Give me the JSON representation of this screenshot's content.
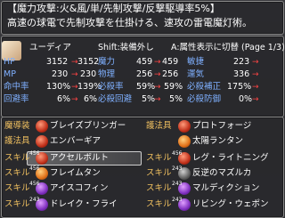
{
  "skill_header": "【魔力攻撃:火&風/単/先制攻撃/反撃駆導率5%】",
  "skill_desc": "高速の球電で先制攻撃を仕掛ける、速攻の雷電魔灯術。",
  "character": {
    "name": "ユーディア",
    "hint_unequip": "Shift:装備外し",
    "hint_toggle": "A:属性表示に切替 (Page 1/3)"
  },
  "stats_left": [
    {
      "label": "HP",
      "value": "3152",
      "arrow": "→",
      "new": "3152"
    },
    {
      "label": "MP",
      "value": "230",
      "arrow": "→",
      "new": "230"
    },
    {
      "label": "命中率",
      "value": "130%",
      "arrow": "→",
      "new": "139%"
    },
    {
      "label": "回避率",
      "value": "6%",
      "arrow": "→",
      "new": "6%"
    }
  ],
  "stats_mid": [
    {
      "label": "魔力",
      "value": "459",
      "arrow": "→",
      "new": "459"
    },
    {
      "label": "物理",
      "value": "256",
      "arrow": "→",
      "new": "256"
    },
    {
      "label": "必殺率",
      "value": "59%",
      "arrow": "→",
      "new": "59%"
    },
    {
      "label": "必殺回避",
      "value": "5%",
      "arrow": "→",
      "new": "5%"
    }
  ],
  "stats_right": [
    {
      "label": "敏捷",
      "value": "223",
      "arrow": "→",
      "new": ""
    },
    {
      "label": "運気",
      "value": "336",
      "arrow": "→",
      "new": ""
    },
    {
      "label": "必殺補正",
      "value": "175%",
      "arrow": "→",
      "new": ""
    },
    {
      "label": "必殺防御",
      "value": "0%",
      "arrow": "→",
      "new": ""
    }
  ],
  "equipment": [
    {
      "slot": "魔導装",
      "item": "ブレイズブリンガー",
      "icon": "fire-orb-icon",
      "level": ""
    },
    {
      "slot": "護法具",
      "item": "エンバーギア",
      "icon": "gear-orb-icon",
      "level": ""
    },
    {
      "slot": "スキル",
      "item": "アクセルボルト",
      "icon": "bolt-orb-icon",
      "level": "456"
    },
    {
      "slot": "スキル",
      "item": "フレイムタン",
      "icon": "flame-orb-icon",
      "level": "456"
    },
    {
      "slot": "スキル",
      "item": "アイスコフィン",
      "icon": "ice-orb-icon",
      "level": "456"
    },
    {
      "slot": "スキル",
      "item": "ドレイク・フライ",
      "icon": "drake-orb-icon",
      "level": "243"
    }
  ],
  "equipment_right": [
    {
      "slot": "護法具",
      "item": "プロトフォージ",
      "icon": "forge-orb-icon",
      "level": ""
    },
    {
      "slot": "",
      "item": "太陽ランタン",
      "icon": "lantern-icon",
      "level": ""
    },
    {
      "slot": "スキル",
      "item": "レグ・ライトニング",
      "icon": "lightning-orb-icon",
      "level": "456"
    },
    {
      "slot": "スキル",
      "item": "反逆のマズルカ",
      "icon": "mazurka-orb-icon",
      "level": "243"
    },
    {
      "slot": "スキル",
      "item": "マルディクション",
      "icon": "curse-orb-icon",
      "level": "243"
    },
    {
      "slot": "スキル",
      "item": "リビング・ウェポン",
      "icon": "weapon-orb-icon",
      "level": "243"
    }
  ],
  "colors": {
    "stat_label": "#7fb0ff",
    "arrow": "#ff4444",
    "highlight": "#cfcfcf"
  }
}
